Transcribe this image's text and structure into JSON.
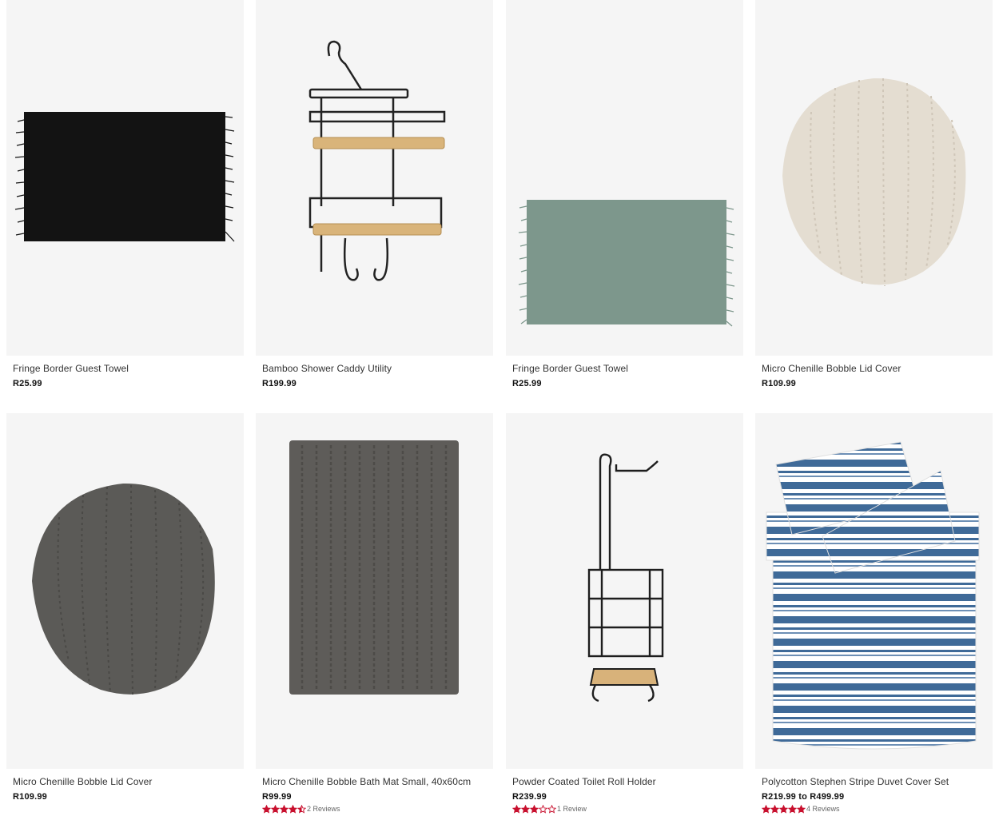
{
  "products": [
    {
      "name": "Fringe Border Guest Towel",
      "price": "R25.99",
      "image": "black-fringe-towel"
    },
    {
      "name": "Bamboo Shower Caddy Utility",
      "price": "R199.99",
      "image": "bamboo-shower-caddy"
    },
    {
      "name": "Fringe Border Guest Towel",
      "price": "R25.99",
      "image": "green-fringe-towel"
    },
    {
      "name": "Micro Chenille Bobble Lid Cover",
      "price": "R109.99",
      "image": "cream-lid-cover"
    },
    {
      "name": "Micro Chenille Bobble Lid Cover",
      "price": "R109.99",
      "image": "grey-lid-cover"
    },
    {
      "name": "Micro Chenille Bobble Bath Mat Small, 40x60cm",
      "price": "R99.99",
      "image": "grey-bath-mat",
      "rating": 4.5,
      "reviews": "2 Reviews"
    },
    {
      "name": "Powder Coated Toilet Roll Holder",
      "price": "R239.99",
      "image": "toilet-roll-holder",
      "rating": 3,
      "reviews": "1 Review"
    },
    {
      "name": "Polycotton Stephen Stripe Duvet Cover Set",
      "price": "R219.99 to R499.99",
      "image": "stripe-duvet-set",
      "rating": 5,
      "reviews": "4 Reviews"
    }
  ],
  "colors": {
    "star_filled": "#c8102e",
    "card_bg": "#f5f5f5",
    "price": "#111111"
  },
  "icons": {
    "star": "star-icon",
    "half_star": "half-star-icon",
    "empty_star": "star-outline-icon"
  }
}
